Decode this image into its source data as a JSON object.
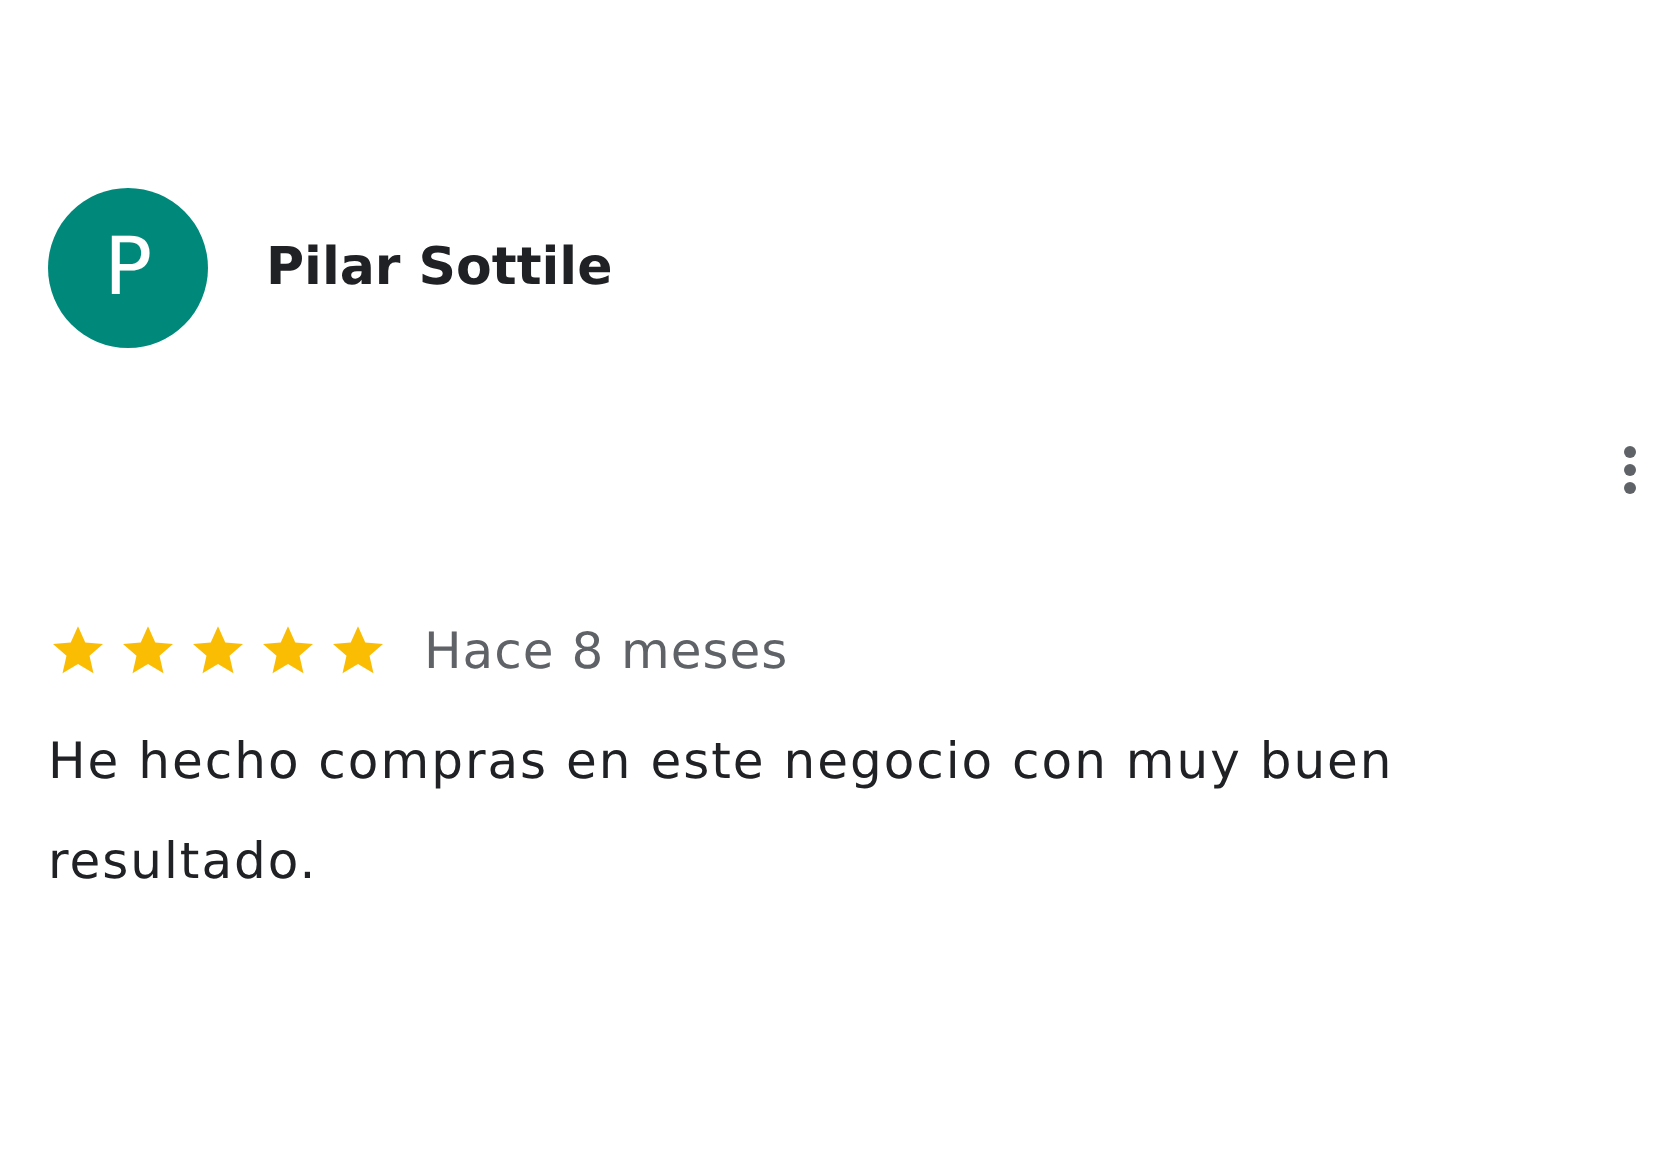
{
  "review": {
    "avatar_letter": "P",
    "color": "#00897b",
    "author": "Pilar Sottile",
    "stars": 5,
    "time": "Hace 8 meses",
    "text": "He hecho compras en este negocio con muy buen resultado."
  }
}
